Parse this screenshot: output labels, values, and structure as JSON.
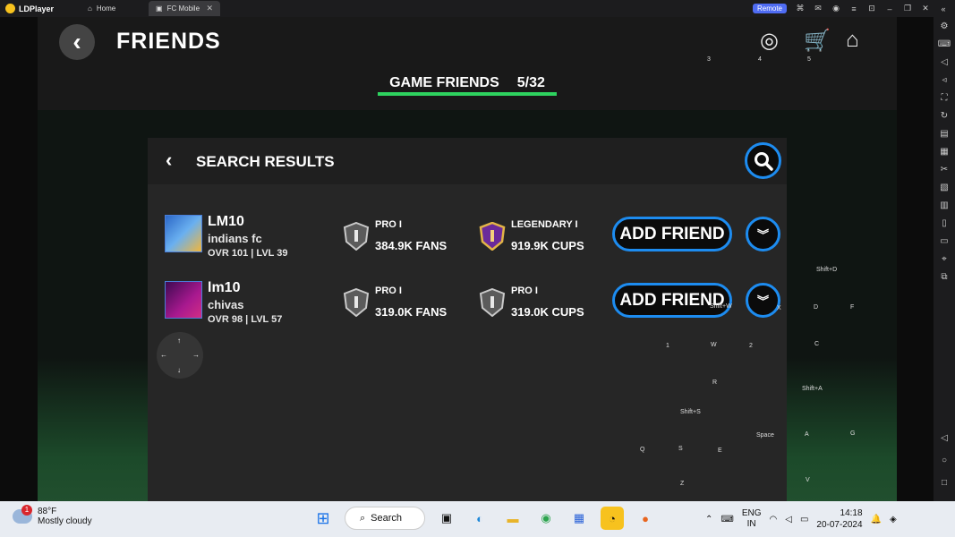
{
  "titlebar": {
    "app_name": "LDPlayer",
    "tabs": [
      {
        "label": "Home"
      },
      {
        "label": "FC Mobile"
      }
    ],
    "remote_label": "Remote"
  },
  "header": {
    "title": "FRIENDS",
    "tab_label": "GAME FRIENDS",
    "friend_count": "5/32"
  },
  "panel": {
    "title": "SEARCH RESULTS",
    "results": [
      {
        "name": "LM10",
        "club": "indians fc",
        "stats": "OVR 101 | LVL 39",
        "division": "PRO I",
        "fans": "384.9K FANS",
        "cup_rank": "LEGENDARY I",
        "cups": "919.9K CUPS",
        "action": "ADD FRIEND"
      },
      {
        "name": "lm10",
        "club": "chivas",
        "stats": "OVR 98 | LVL 57",
        "division": "PRO I",
        "fans": "319.0K FANS",
        "cup_rank": "PRO I",
        "cups": "319.0K CUPS",
        "action": "ADD FRIEND"
      }
    ]
  },
  "key_labels": {
    "k3": "3",
    "k4": "4",
    "k5": "5",
    "shift_d": "Shift+D",
    "shift_w": "Shift+W",
    "x": "X",
    "d": "D",
    "f": "F",
    "one": "1",
    "w": "W",
    "two": "2",
    "c": "C",
    "r": "R",
    "shift_a": "Shift+A",
    "shift_s": "Shift+S",
    "space": "Space",
    "a": "A",
    "g": "G",
    "q": "Q",
    "s": "S",
    "e": "E",
    "v": "V",
    "z": "Z"
  },
  "taskbar": {
    "temperature": "88°F",
    "weather": "Mostly cloudy",
    "notification_count": "1",
    "search_label": "Search",
    "lang_line1": "ENG",
    "lang_line2": "IN",
    "time": "14:18",
    "date": "20-07-2024"
  }
}
